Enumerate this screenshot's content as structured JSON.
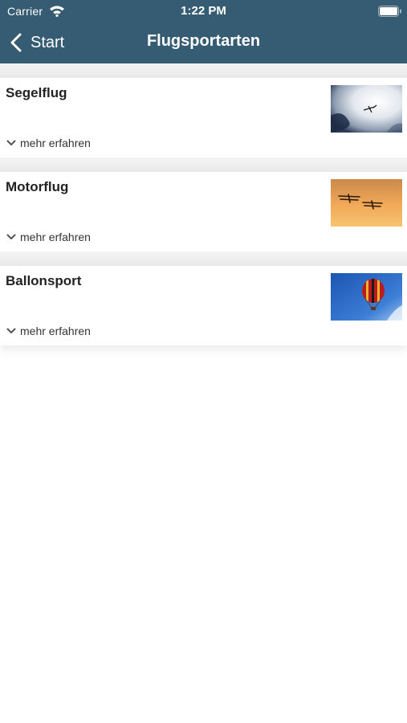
{
  "status_bar": {
    "carrier": "Carrier",
    "time": "1:22 PM"
  },
  "nav_bar": {
    "back_label": "Start",
    "title": "Flugsportarten"
  },
  "items": [
    {
      "title": "Segelflug",
      "more_label": "mehr erfahren",
      "image": "glider-in-clouds"
    },
    {
      "title": "Motorflug",
      "more_label": "mehr erfahren",
      "image": "biplanes-at-sunset"
    },
    {
      "title": "Ballonsport",
      "more_label": "mehr erfahren",
      "image": "hot-air-balloon"
    }
  ],
  "colors": {
    "nav_background": "#355c73",
    "separator": "#ececec"
  }
}
